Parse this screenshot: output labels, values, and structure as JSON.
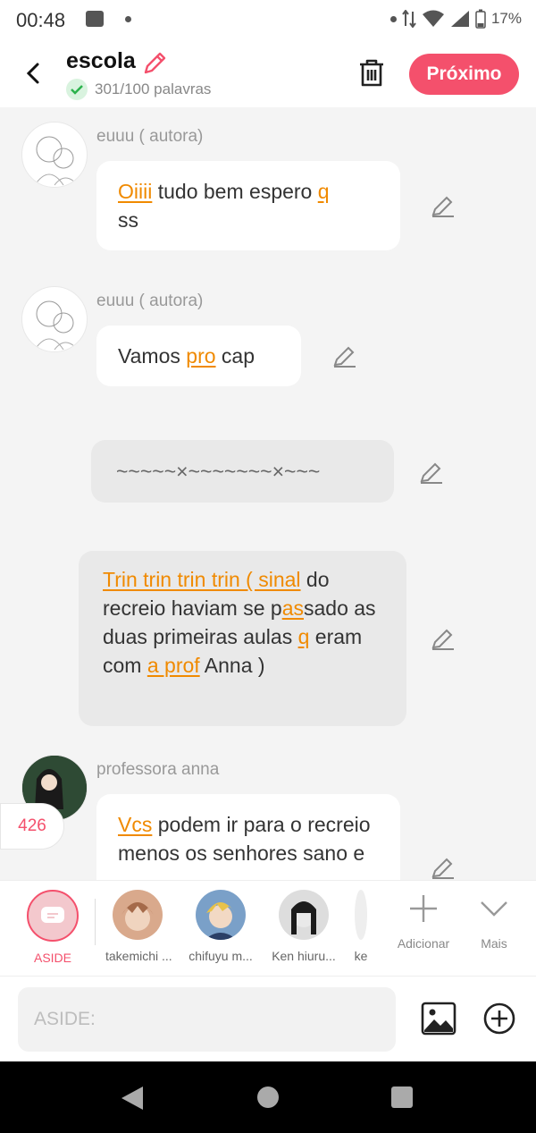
{
  "status": {
    "time": "00:48",
    "battery": "17%"
  },
  "header": {
    "title": "escola",
    "word_count": "301/100 palavras",
    "next_label": "Próximo"
  },
  "messages": [
    {
      "name": "euuu ( autora)",
      "parts": [
        [
          "Oiiii",
          true
        ],
        [
          " tudo bem espero ",
          false
        ],
        [
          "q",
          true
        ],
        [
          " ss",
          false
        ]
      ]
    },
    {
      "name": "euuu ( autora)",
      "parts": [
        [
          "Vamos ",
          false
        ],
        [
          "pro",
          true
        ],
        [
          " cap",
          false
        ]
      ]
    },
    {
      "parts": [
        [
          "~~~~~×~~~~~~~×~~~",
          false
        ]
      ]
    },
    {
      "parts": [
        [
          "Trin trin trin trin ( sinal",
          true
        ],
        [
          " do recreio haviam se p",
          false
        ],
        [
          "as",
          true
        ],
        [
          "sado as duas primeiras aulas ",
          false
        ],
        [
          "q",
          true
        ],
        [
          " eram com ",
          false
        ],
        [
          "a prof",
          true
        ],
        [
          " Anna )",
          false
        ]
      ]
    },
    {
      "name": "professora anna",
      "parts": [
        [
          "Vcs",
          true
        ],
        [
          " podem ir para o recreio menos os senhores sano e",
          false
        ]
      ]
    }
  ],
  "message_count": "426",
  "characters": [
    {
      "label": "ASIDE"
    },
    {
      "label": "takemichi ..."
    },
    {
      "label": "chifuyu m..."
    },
    {
      "label": "Ken hiuru..."
    },
    {
      "label": "ke"
    }
  ],
  "tools": {
    "add": "Adicionar",
    "more": "Mais"
  },
  "input": {
    "placeholder": "ASIDE:"
  },
  "colors": {
    "accent": "#f4506c",
    "highlight": "#f08a00"
  }
}
